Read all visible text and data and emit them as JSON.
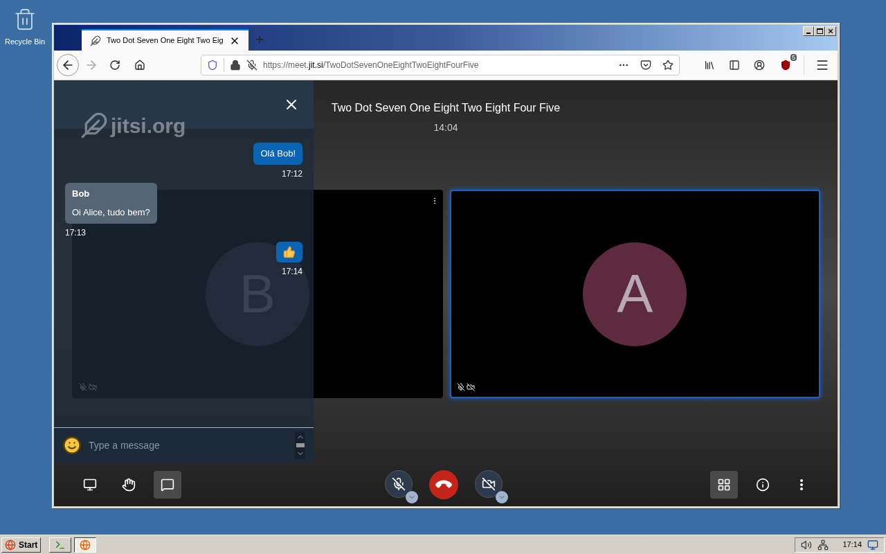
{
  "desktop": {
    "icons": [
      {
        "label": "Recycle Bin"
      }
    ]
  },
  "browser": {
    "tabs": [
      {
        "title": "Two Dot Seven One Eight Two Eig",
        "selected": true
      }
    ],
    "url": {
      "scheme": "https://meet.",
      "domain": "jit.si",
      "path": "/TwoDotSevenOneEightTwoEightFourFive"
    },
    "extension_badge": "5"
  },
  "meeting": {
    "title": "Two Dot Seven One Eight Two Eight Four Five",
    "duration": "14:04",
    "participants": [
      {
        "initial": "B",
        "color": "#2d2c3f",
        "dominant": false,
        "mic_muted": true,
        "camera_off": true
      },
      {
        "initial": "A",
        "color": "#5e2a3d",
        "dominant": true,
        "mic_muted": true,
        "camera_off": true
      }
    ]
  },
  "chat": {
    "watermark": "jitsi.org",
    "messages": [
      {
        "kind": "local",
        "text": "Olá Bob!",
        "time": "17:12"
      },
      {
        "kind": "remote",
        "sender": "Bob",
        "text": "Oi Alice, tudo bem?",
        "time": "17:13"
      },
      {
        "kind": "emoji",
        "time": "17:14"
      }
    ],
    "input": {
      "placeholder": "Type a message"
    }
  },
  "toolbar": {
    "left": [
      {
        "kind": "screen",
        "selected": false
      },
      {
        "kind": "hand",
        "selected": false
      },
      {
        "kind": "chat",
        "selected": true
      }
    ],
    "mic_muted": true,
    "camera_off": true,
    "right": [
      {
        "kind": "tiles",
        "selected": true
      },
      {
        "kind": "info",
        "selected": false
      },
      {
        "kind": "more",
        "selected": false
      }
    ]
  },
  "taskbar": {
    "start": "Start",
    "clock": "17:14",
    "tasks": [
      {
        "kind": "terminal",
        "selected": false
      },
      {
        "kind": "firefox",
        "selected": true
      }
    ]
  }
}
